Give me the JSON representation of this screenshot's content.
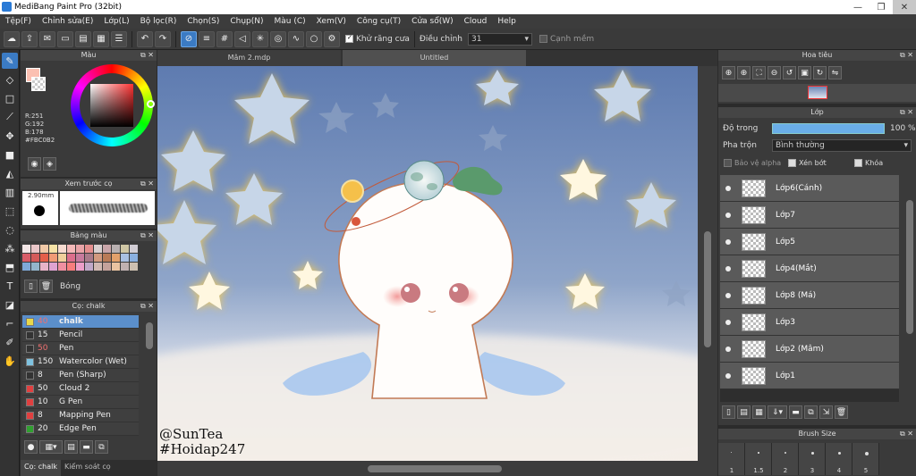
{
  "window": {
    "title": "MediBang Paint Pro (32bit)",
    "min": "—",
    "restore": "❐",
    "close": "✕"
  },
  "menu": [
    "Tệp(F)",
    "Chỉnh sửa(E)",
    "Lớp(L)",
    "Bộ lọc(R)",
    "Chọn(S)",
    "Chụp(N)",
    "Màu (C)",
    "Xem(V)",
    "Công cụ(T)",
    "Cửa sổ(W)",
    "Cloud",
    "Help"
  ],
  "toolbar": {
    "antialias": "Khử răng cưa",
    "correction_label": "Điều chỉnh",
    "correction_value": "31",
    "smooth_label": "Cạnh mềm"
  },
  "color_panel": {
    "title": "Màu",
    "r": "R:251",
    "g": "G:192",
    "b": "B:178",
    "hex": "#FBC0B2",
    "fg_color": "#FBC0B2"
  },
  "brush_preview": {
    "title": "Xem trước cọ",
    "size": "2.90mm"
  },
  "palette": {
    "title": "Bảng màu",
    "label": "Bóng",
    "colors": [
      "#f3e6e6",
      "#e9c6c8",
      "#f1c9a7",
      "#f6e2a6",
      "#f7dbd0",
      "#f4b8b8",
      "#e9a3a7",
      "#e48e8e",
      "#d9d0d0",
      "#c9a5a9",
      "#b8b0b0",
      "#cfc6a4",
      "#d1cdd4",
      "#d85c68",
      "#d45a5a",
      "#e45f4a",
      "#f19b76",
      "#f1cf9c",
      "#dc6e8c",
      "#c77a9d",
      "#a97a8a",
      "#d29a7f",
      "#b97b57",
      "#e3a16b",
      "#a9c0e2",
      "#8ab0e0",
      "#7fa9d8",
      "#94b6cc",
      "#e7b3c8",
      "#dfa3d1",
      "#ef8fa0",
      "#f77d7d",
      "#ec9ec9",
      "#c0a8c8",
      "#d1b9b2",
      "#c4a29b",
      "#e9c3a1",
      "#c0b1b1",
      "#cdbfb0"
    ]
  },
  "brush_panel": {
    "title": "Cọ: chalk",
    "items": [
      {
        "size": "40",
        "name": "chalk",
        "color": "#e8d84a",
        "sel": true
      },
      {
        "size": "15",
        "name": "Pencil",
        "color": "#333333"
      },
      {
        "size": "50",
        "name": "Pen",
        "color": "#333333"
      },
      {
        "size": "150",
        "name": "Watercolor (Wet)",
        "color": "#7fc2e0"
      },
      {
        "size": "8",
        "name": "Pen (Sharp)",
        "color": "#333333"
      },
      {
        "size": "50",
        "name": "Cloud 2",
        "color": "#e04040"
      },
      {
        "size": "10",
        "name": "G Pen",
        "color": "#e04040"
      },
      {
        "size": "8",
        "name": "Mapping Pen",
        "color": "#e04040"
      },
      {
        "size": "20",
        "name": "Edge Pen",
        "color": "#30a030"
      }
    ],
    "tab1": "Cọ: chalk",
    "tab2": "Kiểm soát cọ"
  },
  "doc_tabs": [
    "Mâm 2.mdp",
    "Untitled"
  ],
  "watermark": [
    "@SunTea",
    "#Hoidap247"
  ],
  "navigator": {
    "title": "Hoa tiêu"
  },
  "layer_panel": {
    "title": "Lớp",
    "opacity_label": "Độ trong",
    "opacity_value": "100 %",
    "blend_label": "Pha trộn",
    "blend_value": "Bình thường",
    "alpha": "Bảo vệ alpha",
    "clip": "Xén bớt",
    "lock": "Khóa",
    "layers": [
      "Lớp6(Cánh)",
      "Lớp7",
      "Lớp5",
      "Lớp4(Mắt)",
      "Lớp8 (Má)",
      "Lớp3",
      "Lớp2 (Mâm)",
      "Lớp1"
    ]
  },
  "brush_size": {
    "title": "Brush Size",
    "values": [
      "1",
      "1.5",
      "2",
      "3",
      "4",
      "5"
    ]
  }
}
